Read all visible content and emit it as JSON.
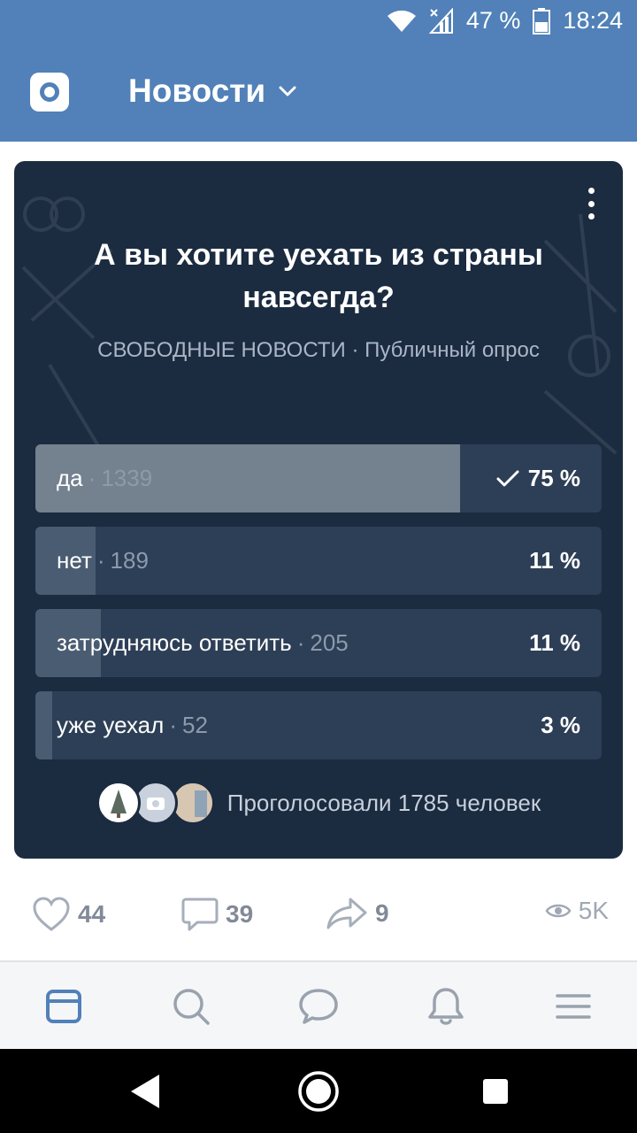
{
  "status_bar": {
    "battery": "47 %",
    "time": "18:24"
  },
  "header": {
    "title": "Новости",
    "icons": [
      "camera-icon",
      "chevron-down-icon"
    ]
  },
  "poll": {
    "question": "А вы хотите уехать из страны навсегда?",
    "source": "СВОБОДНЫЕ НОВОСТИ",
    "separator": "·",
    "type": "Публичный опрос",
    "options": [
      {
        "label": "да",
        "count": "1339",
        "percent": "75 %",
        "fraction": 0.75,
        "chosen": true
      },
      {
        "label": "нет",
        "count": "189",
        "percent": "11 %",
        "fraction": 0.106
      },
      {
        "label": "затрудняюсь ответить",
        "count": "205",
        "percent": "11 %",
        "fraction": 0.115
      },
      {
        "label": "уже уехал",
        "count": "52",
        "percent": "3 %",
        "fraction": 0.029
      }
    ],
    "voters_text": "Проголосовали 1785 человек",
    "colors": {
      "card_bg": "#1b2b40",
      "bar_bg": "#2d3f56",
      "bar_fill": "#4a5c72",
      "bar_chosen": "#74818f"
    }
  },
  "actions": {
    "likes": "44",
    "comments": "39",
    "shares": "9",
    "views": "5K"
  },
  "tabbar": {
    "tabs": [
      "news-icon",
      "search-icon",
      "messages-icon",
      "notifications-icon",
      "menu-icon"
    ],
    "accent": "#5181b8"
  },
  "colors": {
    "brand": "#5181b8"
  }
}
